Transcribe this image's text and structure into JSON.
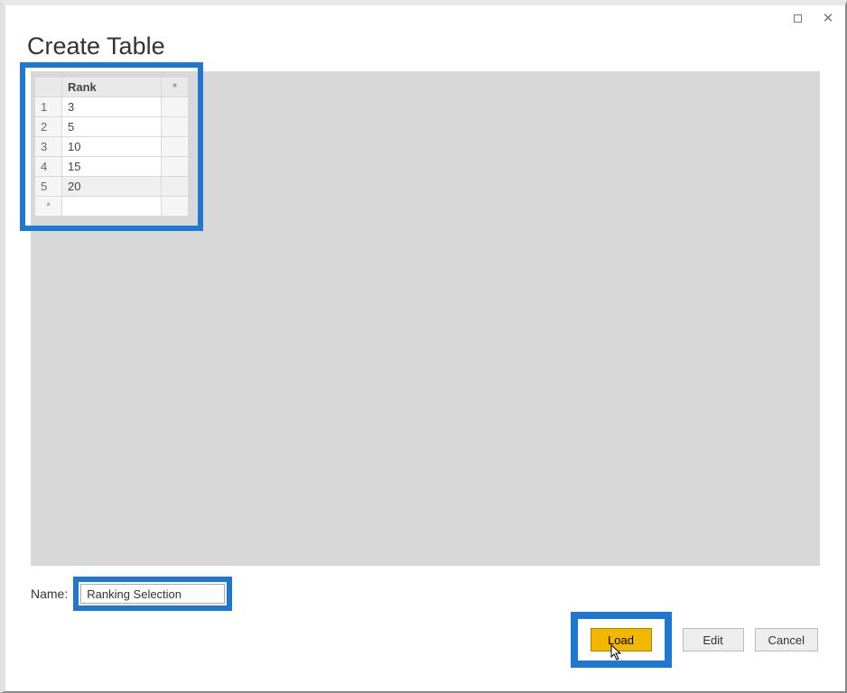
{
  "dialog": {
    "title": "Create Table",
    "name_label": "Name:",
    "name_value": "Ranking Selection"
  },
  "buttons": {
    "load": "Load",
    "edit": "Edit",
    "cancel": "Cancel"
  },
  "table": {
    "header": "Rank",
    "star": "*",
    "rows": [
      {
        "idx": "1",
        "val": "3"
      },
      {
        "idx": "2",
        "val": "5"
      },
      {
        "idx": "3",
        "val": "10"
      },
      {
        "idx": "4",
        "val": "15"
      },
      {
        "idx": "5",
        "val": "20"
      }
    ]
  }
}
